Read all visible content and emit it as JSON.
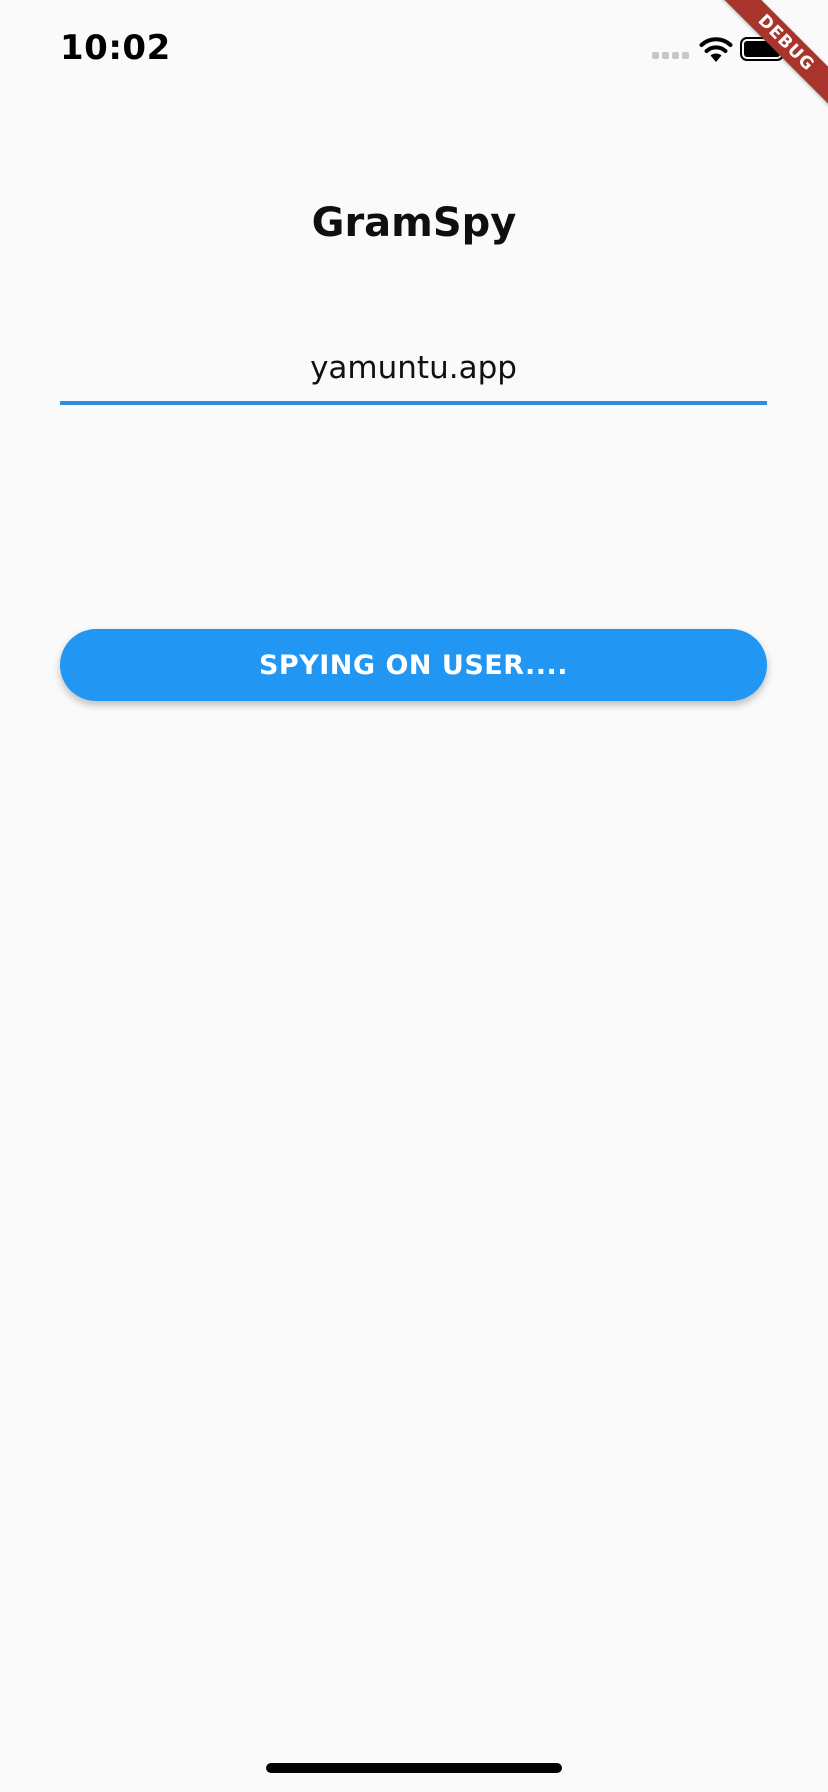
{
  "status_bar": {
    "time": "10:02",
    "icons": [
      "signal-icon",
      "wifi-icon",
      "battery-icon"
    ]
  },
  "debug_banner": {
    "label": "DEBUG",
    "color": "#a8342c"
  },
  "app": {
    "title": "GramSpy",
    "username_input": {
      "value": "yamuntu.app",
      "underline_color": "#2f8ee0"
    },
    "spy_button": {
      "label": "SPYING ON USER....",
      "color": "#2196f3"
    }
  }
}
